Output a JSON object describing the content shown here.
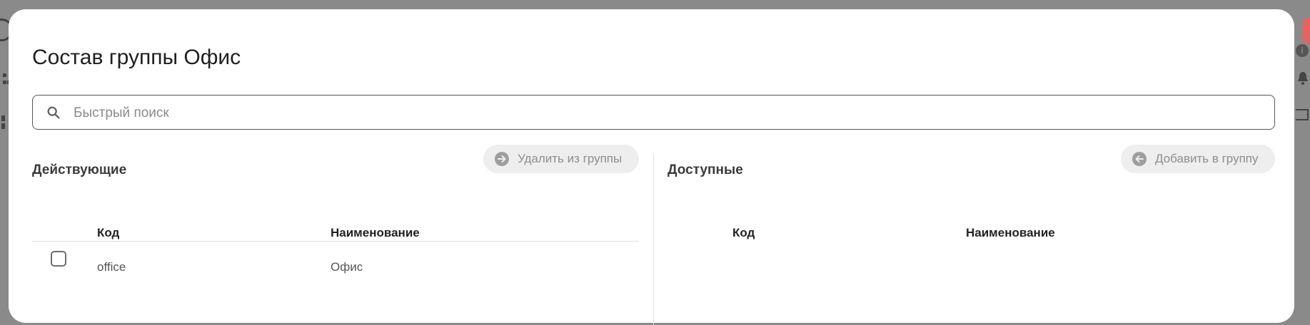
{
  "dialog": {
    "title": "Состав группы Офис"
  },
  "search": {
    "placeholder": "Быстрый поиск",
    "value": ""
  },
  "active_panel": {
    "title": "Действующие",
    "action_label": "Удалить из группы",
    "columns": [
      "Код",
      "Наименование"
    ],
    "rows": [
      {
        "code": "office",
        "name": "Офис",
        "checked": false
      }
    ]
  },
  "available_panel": {
    "title": "Доступные",
    "action_label": "Добавить в группу",
    "columns": [
      "Код",
      "Наименование"
    ],
    "rows": []
  },
  "colors": {
    "overlay": "#8a8a8a",
    "surface": "#ffffff",
    "button_bg": "#eeeeee",
    "button_text": "#8e8e8e"
  },
  "icons": {
    "search": "search-icon",
    "remove": "arrow-right-circle-icon",
    "add": "arrow-left-circle-icon"
  }
}
